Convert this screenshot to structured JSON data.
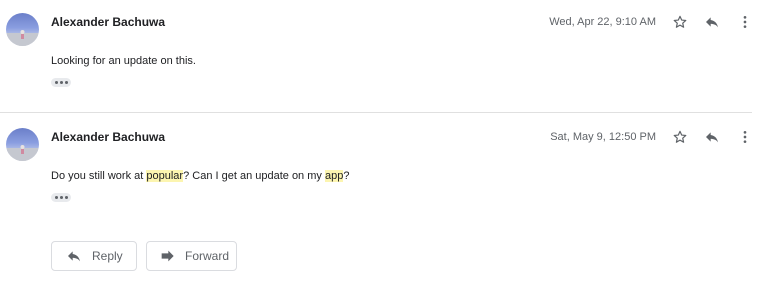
{
  "messages": [
    {
      "sender": "Alexander Bachuwa",
      "date": "Wed, Apr 22, 9:10 AM",
      "body": "Looking for an update on this."
    },
    {
      "sender": "Alexander Bachuwa",
      "date": "Sat, May 9, 12:50 PM",
      "body_parts": {
        "p1": "Do you still work at ",
        "h1": "popular",
        "p2": "? Can I get an update on my ",
        "h2": "app",
        "p3": "?"
      }
    }
  ],
  "actions": {
    "reply_label": "Reply",
    "forward_label": "Forward"
  },
  "icons": {
    "star": "star-outline-icon",
    "reply": "reply-arrow-icon",
    "more": "more-vertical-icon",
    "forward": "forward-arrow-icon"
  },
  "colors": {
    "highlight": "#fcf5b0",
    "icon": "#5f6368"
  }
}
